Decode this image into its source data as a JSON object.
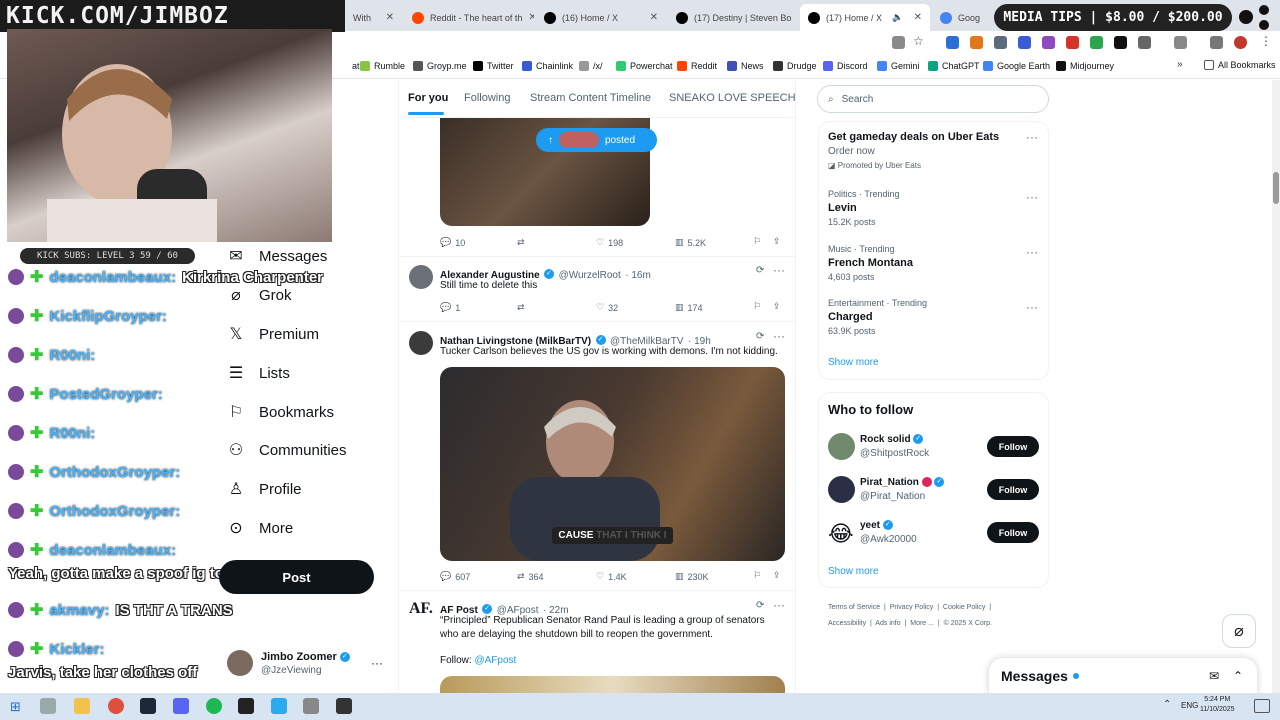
{
  "overlay": {
    "kick_title": "KICK.COM/JIMBOZ",
    "media_tips": "MEDIA TIPS | $8.00 / $200.00",
    "kick_subs": "KICK SUBS: LEVEL 3 59 / 60"
  },
  "browser": {
    "tabs": [
      {
        "title": "With",
        "icon_color": "#e0e0e0"
      },
      {
        "title": "Reddit - The heart of th",
        "icon_color": "#ff4500"
      },
      {
        "title": "(16) Home / X",
        "icon_color": "#000000"
      },
      {
        "title": "(17) Destiny | Steven Bo",
        "icon_color": "#000000"
      },
      {
        "title": "(17) Home / X",
        "icon_color": "#000000"
      },
      {
        "title": "Goog",
        "icon_color": "#4285f4"
      }
    ],
    "bookmarks": [
      {
        "label": "at",
        "icon_color": "#ffffff"
      },
      {
        "label": "Rumble",
        "icon_color": "#85c742"
      },
      {
        "label": "Groyp.me",
        "icon_color": "#555555"
      },
      {
        "label": "Twitter",
        "icon_color": "#000000"
      },
      {
        "label": "Chainlink",
        "icon_color": "#375bd2"
      },
      {
        "label": "/x/",
        "icon_color": "#999999"
      },
      {
        "label": "Powerchat",
        "icon_color": "#2ecc71"
      },
      {
        "label": "Reddit",
        "icon_color": "#ff4500"
      },
      {
        "label": "News",
        "icon_color": "#3f51b5"
      },
      {
        "label": "Drudge",
        "icon_color": "#333333"
      },
      {
        "label": "Discord",
        "icon_color": "#5865f2"
      },
      {
        "label": "Gemini",
        "icon_color": "#4285f4"
      },
      {
        "label": "ChatGPT",
        "icon_color": "#10a37f"
      },
      {
        "label": "Google Earth",
        "icon_color": "#4285f4"
      },
      {
        "label": "Midjourney",
        "icon_color": "#111111"
      }
    ],
    "all_bookmarks": "All Bookmarks"
  },
  "chat": [
    {
      "user": "deaconlambeaux:",
      "msg": "Kirkrina Charpenter"
    },
    {
      "user": "KickflipGroyper:",
      "msg": ""
    },
    {
      "user": "R00ni:",
      "msg": ""
    },
    {
      "user": "PostedGroyper:",
      "msg": ""
    },
    {
      "user": "R00ni:",
      "msg": ""
    },
    {
      "user": "OrthodoxGroyper:",
      "msg": ""
    },
    {
      "user": "OrthodoxGroyper:",
      "msg": ""
    },
    {
      "user": "deaconlambeaux:",
      "msg": ""
    },
    {
      "user": "",
      "msg": "Yeah, gotta make a spoof ig to share"
    },
    {
      "user": "akmavy:",
      "msg": "IS THT A TRANS"
    },
    {
      "user": "Kickler:",
      "msg": ""
    },
    {
      "user": "",
      "msg": "Jarvis, take her clothes off"
    }
  ],
  "nav": {
    "items": [
      "Messages",
      "Grok",
      "Premium",
      "Lists",
      "Bookmarks",
      "Communities",
      "Profile",
      "More"
    ],
    "post": "Post",
    "account_name": "Jimbo Zoomer",
    "account_handle": "@JzeViewing"
  },
  "feed": {
    "tabs": [
      "For you",
      "Following",
      "Stream Content Timeline",
      "SNEAKO LOVE SPEECH"
    ],
    "posted_pill": "posted",
    "top_actions": {
      "replies": "10",
      "likes": "198",
      "views": "5.2K"
    },
    "tweets": [
      {
        "name": "Alexander Augustine",
        "handle": "@WurzelRoot",
        "time": "· 16m",
        "text": "Still time to delete this",
        "replies": "1",
        "retweets": "",
        "likes": "32",
        "views": "174"
      },
      {
        "name": "Nathan Livingstone (MilkBarTV)",
        "handle": "@TheMilkBarTV",
        "time": "· 19h",
        "text": "Tucker Carlson believes the US gov is working with demons. I'm not kidding.",
        "caption": "CAUSE",
        "video_caption_dim": "THAT I THINK I",
        "replies": "607",
        "retweets": "364",
        "likes": "1.4K",
        "views": "230K"
      },
      {
        "name": "AF Post",
        "handle": "@AFpost",
        "time": "· 22m",
        "text": "“Principled” Republican Senator Rand Paul is leading a group of senators who are delaying the shutdown bill to reopen the government.",
        "follow_label": "Follow:",
        "follow_handle": "@AFpost"
      }
    ]
  },
  "right": {
    "search_placeholder": "Search",
    "promo": {
      "title": "Get gameday deals on Uber Eats",
      "sub": "Order now",
      "promoted": "Promoted by Uber Eats"
    },
    "trends": [
      {
        "category": "Politics · Trending",
        "name": "Levin",
        "posts": "15.2K posts"
      },
      {
        "category": "Music · Trending",
        "name": "French Montana",
        "posts": "4,603 posts"
      },
      {
        "category": "Entertainment · Trending",
        "name": "Charged",
        "posts": "63.9K posts"
      }
    ],
    "show_more": "Show more",
    "who_to_follow": "Who to follow",
    "follows": [
      {
        "name": "Rock solid",
        "handle": "@ShitpostRock",
        "button": "Follow"
      },
      {
        "name": "Pirat_Nation",
        "handle": "@Pirat_Nation",
        "button": "Follow"
      },
      {
        "name": "yeet",
        "handle": "@Awk20000",
        "button": "Follow"
      }
    ],
    "footer_links": [
      "Terms of Service",
      "Privacy Policy",
      "Cookie Policy",
      "Accessibility",
      "Ads info",
      "More ...",
      "© 2025 X Corp."
    ],
    "messages": "Messages"
  },
  "taskbar": {
    "lang": "ENG",
    "time": "5:24 PM",
    "date": "11/10/2025"
  }
}
